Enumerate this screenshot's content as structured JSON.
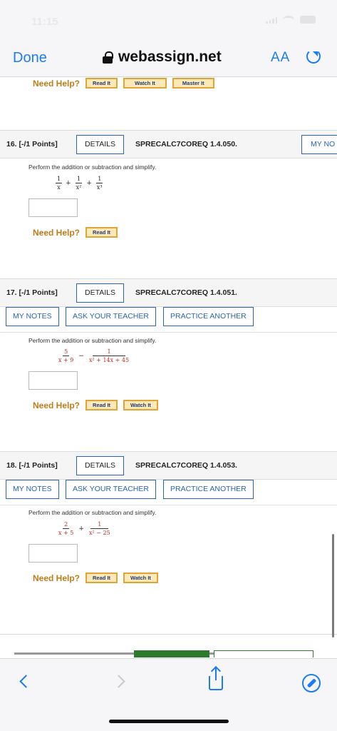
{
  "status": {
    "time": "11:15"
  },
  "browser": {
    "done_label": "Done",
    "url": "webassign.net",
    "text_size_label": "AA"
  },
  "help": {
    "label": "Need Help?",
    "read": "Read It",
    "watch": "Watch It",
    "master": "Master It"
  },
  "questions": [
    {
      "number": "16. [-/1 Points]",
      "details": "DETAILS",
      "code": "SPRECALC7COREQ 1.4.050.",
      "my_notes_partial": "MY NO",
      "prompt": "Perform the addition or subtraction and simplify.",
      "math": {
        "t1_num": "1",
        "t1_den": "x",
        "op1": "+",
        "t2_num": "1",
        "t2_den": "x²",
        "op2": "+",
        "t3_num": "1",
        "t3_den": "x³"
      }
    },
    {
      "number": "17. [-/1 Points]",
      "details": "DETAILS",
      "code": "SPRECALC7COREQ 1.4.051.",
      "my_notes": "MY NOTES",
      "ask_teacher": "ASK YOUR TEACHER",
      "practice": "PRACTICE ANOTHER",
      "prompt": "Perform the addition or subtraction and simplify.",
      "math": {
        "t1_num": "5",
        "t1_den": "x + 9",
        "op1": "−",
        "t2_num": "1",
        "t2_den": "x² + 14x + 45"
      }
    },
    {
      "number": "18. [-/1 Points]",
      "details": "DETAILS",
      "code": "SPRECALC7COREQ 1.4.053.",
      "my_notes": "MY NOTES",
      "ask_teacher": "ASK YOUR TEACHER",
      "practice": "PRACTICE ANOTHER",
      "prompt": "Perform the addition or subtraction and simplify.",
      "math": {
        "t1_num": "2",
        "t1_den": "x + 5",
        "op1": "+",
        "t2_num": "1",
        "t2_den": "x² − 25"
      }
    }
  ],
  "colors": {
    "accent": "#1b7cf4",
    "button_border": "#2a64b8",
    "help": "#c17d17",
    "math_red": "#c0281e"
  },
  "icons": [
    "lock-icon",
    "reload-icon",
    "back-icon",
    "forward-icon",
    "share-icon",
    "compass-icon"
  ]
}
